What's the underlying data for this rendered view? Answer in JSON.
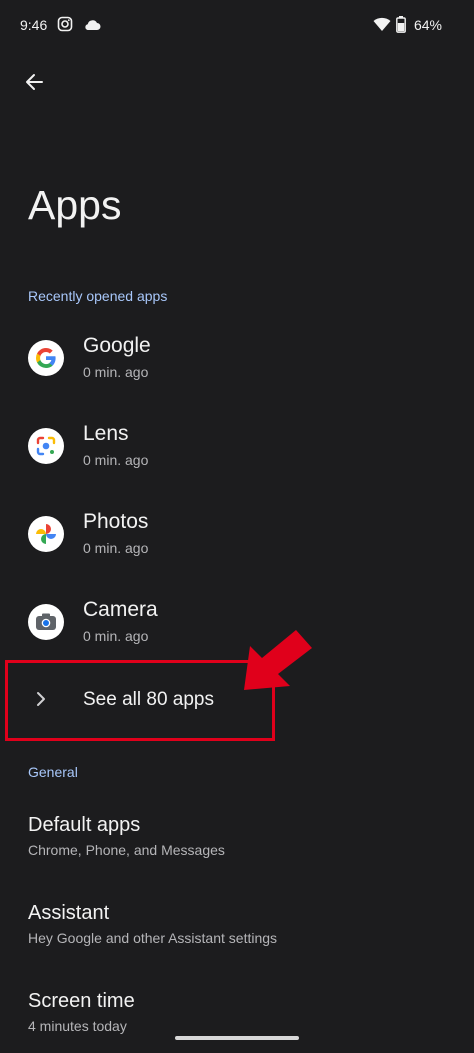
{
  "status_bar": {
    "time": "9:46",
    "battery": "64%"
  },
  "header": {
    "title": "Apps"
  },
  "recent": {
    "header": "Recently opened apps",
    "apps": [
      {
        "name": "Google",
        "time": "0 min. ago",
        "icon": "google-icon"
      },
      {
        "name": "Lens",
        "time": "0 min. ago",
        "icon": "lens-icon"
      },
      {
        "name": "Photos",
        "time": "0 min. ago",
        "icon": "photos-icon"
      },
      {
        "name": "Camera",
        "time": "0 min. ago",
        "icon": "camera-icon"
      }
    ],
    "see_all": "See all 80 apps"
  },
  "general": {
    "header": "General",
    "items": [
      {
        "title": "Default apps",
        "subtitle": "Chrome, Phone, and Messages"
      },
      {
        "title": "Assistant",
        "subtitle": "Hey Google and other Assistant settings"
      },
      {
        "title": "Screen time",
        "subtitle": "4 minutes today"
      }
    ]
  },
  "colors": {
    "background": "#1c1c1e",
    "accent": "#a8c7fa",
    "highlight": "#e0001b"
  }
}
